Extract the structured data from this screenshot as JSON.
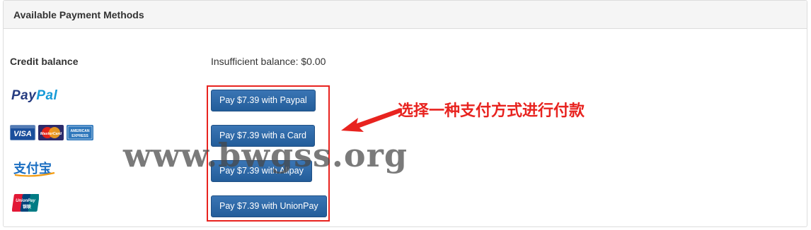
{
  "panel": {
    "title": "Available Payment Methods"
  },
  "credit": {
    "label": "Credit balance",
    "status": "Insufficient balance: $0.00"
  },
  "methods": {
    "paypal": {
      "logo_part1": "Pay",
      "logo_part2": "Pal",
      "button": "Pay $7.39 with Paypal"
    },
    "card": {
      "logo_text": [
        "VISA",
        "MasterCard",
        "AMERICAN EXPRESS"
      ],
      "button": "Pay $7.39 with a Card"
    },
    "alipay": {
      "logo_text": "支付宝",
      "button": "Pay $7.39 with Alipay"
    },
    "unionpay": {
      "logo_text": [
        "UnionPay",
        "银联"
      ],
      "button": "Pay $7.39 with UnionPay"
    }
  },
  "annotation": {
    "text": "选择一种支付方式进行付款",
    "color": "#e8231f"
  },
  "watermark": {
    "text": "www.bwgss.org"
  },
  "colors": {
    "button": "#2a6aab",
    "highlight": "#e8231f",
    "paypal_dark": "#253b80",
    "paypal_light": "#179bd7"
  }
}
